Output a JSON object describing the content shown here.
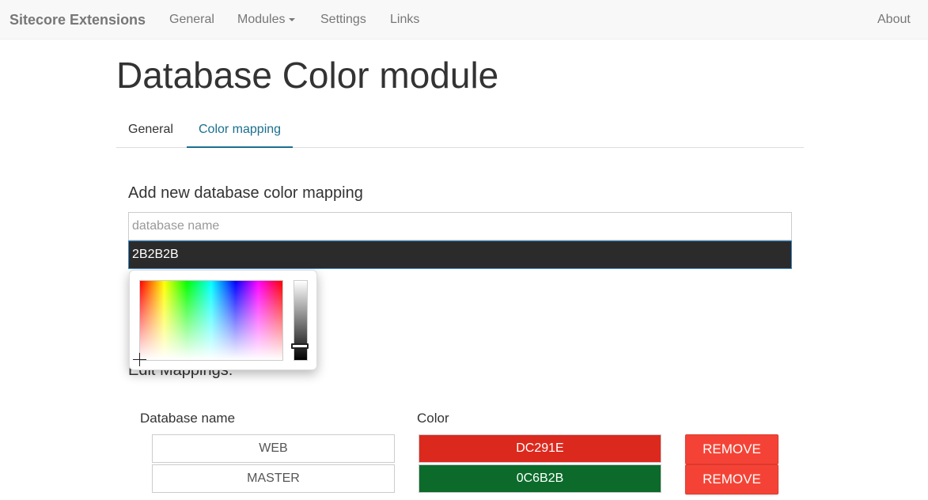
{
  "navbar": {
    "brand": "Sitecore Extensions",
    "items": [
      {
        "label": "General"
      },
      {
        "label": "Modules"
      },
      {
        "label": "Settings"
      },
      {
        "label": "Links"
      }
    ],
    "about": "About"
  },
  "page": {
    "title": "Database Color module"
  },
  "tabs": [
    {
      "label": "General",
      "active": false
    },
    {
      "label": "Color mapping",
      "active": true
    }
  ],
  "add_section": {
    "heading": "Add new database color mapping",
    "name_placeholder": "database name",
    "name_value": "",
    "color_value": "2B2B2B"
  },
  "color_picker": {
    "open": true,
    "icons": [
      "crosshair-icon",
      "slider-handle-icon"
    ]
  },
  "edit_section": {
    "heading": "Edit Mappings:",
    "columns": [
      "Database name",
      "Color"
    ],
    "rows": [
      {
        "name": "WEB",
        "color": "DC291E",
        "remove_label": "REMOVE"
      },
      {
        "name": "MASTER",
        "color": "0C6B2B",
        "remove_label": "REMOVE"
      }
    ]
  },
  "colors": {
    "navbar_bg": "#f8f8f8",
    "active_tab": "#1a6f8e",
    "remove_button": "#f44336",
    "input_focus_border": "#3c88c8"
  }
}
